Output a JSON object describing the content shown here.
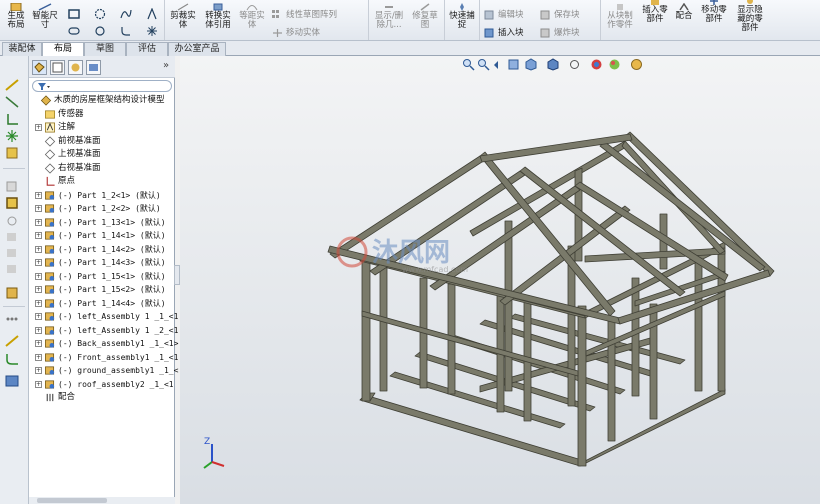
{
  "ribbon": {
    "buttons": [
      {
        "label": "生成\n布局",
        "icon": "layout-icon"
      },
      {
        "label": "智能尺\n寸",
        "icon": "smart-dimension-icon"
      },
      {
        "label": "剪裁实\n体",
        "icon": "trim-entities-icon"
      },
      {
        "label": "转换实\n体引用",
        "icon": "convert-entities-icon"
      },
      {
        "label": "等距实\n体",
        "icon": "offset-entities-icon"
      },
      {
        "label": "显示/删\n除几...",
        "icon": "display-delete-relations-icon"
      },
      {
        "label": "修复草\n图",
        "icon": "repair-sketch-icon"
      },
      {
        "label": "快速捕\n捉",
        "icon": "quick-snaps-icon"
      },
      {
        "label": "从块制\n作零件",
        "icon": "make-part-from-block-icon"
      },
      {
        "label": "插入零\n部件",
        "icon": "insert-component-icon"
      },
      {
        "label": "配合",
        "icon": "mate-icon"
      },
      {
        "label": "移动零\n部件",
        "icon": "move-component-icon"
      },
      {
        "label": "显示隐\n藏的零\n部件",
        "icon": "show-hidden-components-icon"
      }
    ],
    "small_items": [
      {
        "label": "线性草图阵列",
        "icon": "linear-pattern-icon"
      },
      {
        "label": "移动实体",
        "icon": "move-entities-icon"
      },
      {
        "label": "编辑块",
        "icon": "edit-block-icon"
      },
      {
        "label": "插入块",
        "icon": "insert-block-icon"
      },
      {
        "label": "保存块",
        "icon": "save-block-icon"
      },
      {
        "label": "爆炸块",
        "icon": "explode-block-icon"
      }
    ]
  },
  "tabs": [
    {
      "label": "装配体",
      "active": false
    },
    {
      "label": "布局",
      "active": true
    },
    {
      "label": "草图",
      "active": false
    },
    {
      "label": "评估",
      "active": false
    },
    {
      "label": "办公室产品",
      "active": false
    }
  ],
  "tree": {
    "filter_icon": "filter-icon",
    "more_icon": "double-chevron-right-icon",
    "items": [
      {
        "label": "木质的房屋框架结构设计模型",
        "icon": "assembly-icon",
        "indent": 0,
        "expander": ""
      },
      {
        "label": "传感器",
        "icon": "sensor-folder-icon",
        "indent": 1,
        "expander": ""
      },
      {
        "label": "注解",
        "icon": "annotation-icon",
        "indent": 1,
        "expander": "+"
      },
      {
        "label": "前视基准面",
        "icon": "plane-icon",
        "indent": 1,
        "expander": ""
      },
      {
        "label": "上视基准面",
        "icon": "plane-icon",
        "indent": 1,
        "expander": ""
      },
      {
        "label": "右视基准面",
        "icon": "plane-icon",
        "indent": 1,
        "expander": ""
      },
      {
        "label": "原点",
        "icon": "origin-icon",
        "indent": 1,
        "expander": ""
      },
      {
        "label": "(-) Part 1_2<1> (默认)",
        "icon": "part-icon",
        "indent": 1,
        "expander": "+"
      },
      {
        "label": "(-) Part 1_2<2> (默认)",
        "icon": "part-icon",
        "indent": 1,
        "expander": "+"
      },
      {
        "label": "(-) Part 1_13<1> (默认)",
        "icon": "part-icon",
        "indent": 1,
        "expander": "+"
      },
      {
        "label": "(-) Part 1_14<1> (默认)",
        "icon": "part-icon",
        "indent": 1,
        "expander": "+"
      },
      {
        "label": "(-) Part 1_14<2> (默认)",
        "icon": "part-icon",
        "indent": 1,
        "expander": "+"
      },
      {
        "label": "(-) Part 1_14<3> (默认)",
        "icon": "part-icon",
        "indent": 1,
        "expander": "+"
      },
      {
        "label": "(-) Part 1_15<1> (默认)",
        "icon": "part-icon",
        "indent": 1,
        "expander": "+"
      },
      {
        "label": "(-) Part 1_15<2> (默认)",
        "icon": "part-icon",
        "indent": 1,
        "expander": "+"
      },
      {
        "label": "(-) Part 1_14<4> (默认)",
        "icon": "part-icon",
        "indent": 1,
        "expander": "+"
      },
      {
        "label": "(-) left_Assembly 1 _1_<1",
        "icon": "subassembly-icon",
        "indent": 1,
        "expander": "+"
      },
      {
        "label": "(-) left_Assembly 1 _2_<1",
        "icon": "subassembly-icon",
        "indent": 1,
        "expander": "+"
      },
      {
        "label": "(-) Back_assembly1 _1_<1>",
        "icon": "subassembly-icon",
        "indent": 1,
        "expander": "+"
      },
      {
        "label": "(-) Front_assembly1 _1_<1",
        "icon": "subassembly-icon",
        "indent": 1,
        "expander": "+"
      },
      {
        "label": "(-) ground_assembly1 _1_<",
        "icon": "subassembly-icon",
        "indent": 1,
        "expander": "+"
      },
      {
        "label": "(-) roof_assembly2 _1_<1",
        "icon": "subassembly-icon",
        "indent": 1,
        "expander": "+"
      },
      {
        "label": "配合",
        "icon": "mates-folder-icon",
        "indent": 1,
        "expander": ""
      }
    ]
  },
  "viewport": {
    "watermark_title": "沐风网",
    "watermark_url": "www.mfcad.com",
    "triad_axis_label": "Z",
    "model_color": "#6e6e60",
    "background_top": "#f3f4f5",
    "background_bottom": "#d9dee4"
  }
}
